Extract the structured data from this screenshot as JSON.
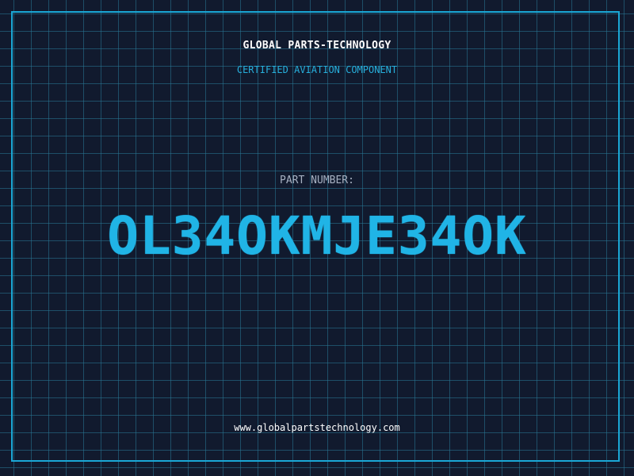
{
  "header": {
    "company": "GLOBAL PARTS-TECHNOLOGY",
    "subtitle": "CERTIFIED AVIATION COMPONENT"
  },
  "part": {
    "label": "PART NUMBER:",
    "number": "OL34OKMJE34OK"
  },
  "footer": {
    "website": "www.globalpartstechnology.com"
  },
  "colors": {
    "background": "#111a2e",
    "grid": "#287896",
    "accent": "#20b4e6",
    "frame": "#1aa7d6",
    "label": "#a7b1c2",
    "text": "#ffffff"
  }
}
